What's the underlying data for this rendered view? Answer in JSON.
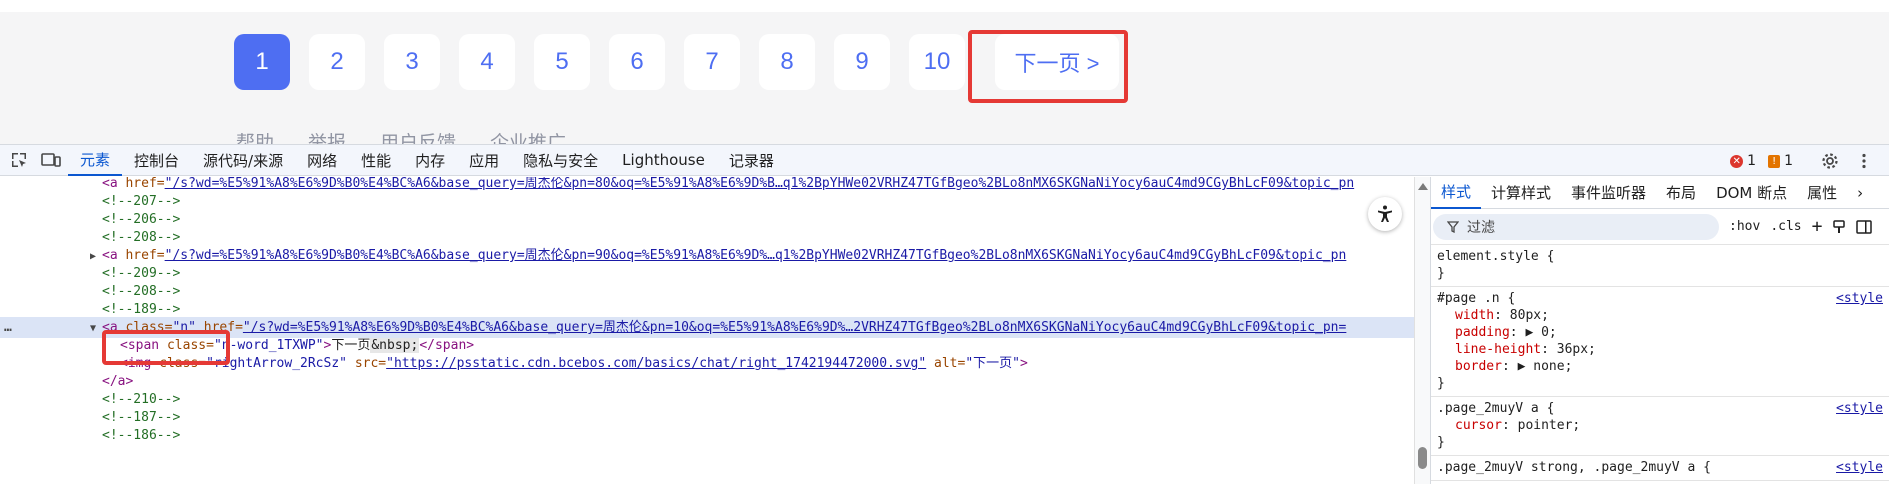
{
  "pager": {
    "pages": [
      "1",
      "2",
      "3",
      "4",
      "5",
      "6",
      "7",
      "8",
      "9",
      "10"
    ],
    "active_page": "1",
    "next_label": "下一页 >"
  },
  "footer_links": [
    "帮助",
    "举报",
    "用户反馈",
    "企业推广"
  ],
  "devtools": {
    "tabs": [
      "元素",
      "控制台",
      "源代码/来源",
      "网络",
      "性能",
      "内存",
      "应用",
      "隐私与安全",
      "Lighthouse",
      "记录器"
    ],
    "active_tab": "元素",
    "error_count": "1",
    "warning_count": "1",
    "error_glyph": "✕",
    "warning_glyph": "!"
  },
  "elements": {
    "lines": [
      {
        "type": "link-partial",
        "indent": 2,
        "tag_open": "<a ",
        "attr": "href=",
        "val": "\"/s?wd=%E5%91%A8%E6%9D%B0%E4%BC%A6&base_query=周杰伦&pn=80&oq=%E5%91%A8%E6%9D%B…q1%2BpYHWe02VRHZ47TGfBgeo%2BLo8nMX6SKGNaNiYocy6auC4md9CGyBhLcF09&topic_pn"
      },
      {
        "type": "comment",
        "indent": 2,
        "text": "<!--207-->"
      },
      {
        "type": "comment",
        "indent": 2,
        "text": "<!--206-->"
      },
      {
        "type": "comment",
        "indent": 2,
        "text": "<!--208-->"
      },
      {
        "type": "link",
        "indent": 2,
        "tri": "▶",
        "tag_open": "<a ",
        "attr": "href=",
        "val": "\"/s?wd=%E5%91%A8%E6%9D%B0%E4%BC%A6&base_query=周杰伦&pn=90&oq=%E5%91%A8%E6%9D%…q1%2BpYHWe02VRHZ47TGfBgeo%2BLo8nMX6SKGNaNiYocy6auC4md9CGyBhLcF09&topic_pn"
      },
      {
        "type": "comment",
        "indent": 2,
        "text": "<!--209-->"
      },
      {
        "type": "comment",
        "indent": 2,
        "text": "<!--208-->"
      },
      {
        "type": "comment",
        "indent": 2,
        "text": "<!--189-->"
      },
      {
        "type": "selected",
        "indent": 2,
        "tri": "▼",
        "tag_open": "<a ",
        "class_attr": "class=",
        "class_val": "\"n\"",
        "attr": " href=",
        "val": "\"/s?wd=%E5%91%A8%E6%9D%B0%E4%BC%A6&base_query=周杰伦&pn=10&oq=%E5%91%A8%E6%9D%…2VRHZ47TGfBgeo%2BLo8nMX6SKGNaNiYocy6auC4md9CGyBhLcF09&topic_pn="
      },
      {
        "type": "span",
        "indent": 3,
        "tag_open": "<span ",
        "attr": "class=",
        "val": "\"n-word_1TXWP\"",
        "close_open": ">",
        "text": "下一页",
        "nbsp": "&nbsp;",
        "tag_close": "</span>"
      },
      {
        "type": "img",
        "indent": 3,
        "tag_open": "<img ",
        "attr1": "class=",
        "val1": "\"rightArrow_2RcSz\"",
        "attr2": " src=",
        "val2": "\"https://psstatic.cdn.bcebos.com/basics/chat/right_1742194472000.svg\"",
        "attr3": " alt=",
        "val3": "\"下一页\"",
        "tag_end": ">"
      },
      {
        "type": "close",
        "indent": 2,
        "text": "</a>"
      },
      {
        "type": "comment",
        "indent": 2,
        "text": "<!--210-->"
      },
      {
        "type": "comment",
        "indent": 2,
        "text": "<!--187-->"
      },
      {
        "type": "comment",
        "indent": 2,
        "text": "<!--186-->"
      }
    ],
    "selected_dots": "…"
  },
  "styles_panel": {
    "tabs": [
      "样式",
      "计算样式",
      "事件监听器",
      "布局",
      "DOM 断点",
      "属性"
    ],
    "active_tab": "样式",
    "filter_placeholder": "过滤",
    "hov_label": ":hov",
    "cls_label": ".cls",
    "plus_label": "+",
    "rules": [
      {
        "selector": "element.style {",
        "props": [],
        "close": "}",
        "source": ""
      },
      {
        "selector": "#page .n {",
        "props": [
          {
            "name": "width",
            "value": "80px;"
          },
          {
            "name": "padding",
            "value": "▶ 0;"
          },
          {
            "name": "line-height",
            "value": "36px;"
          },
          {
            "name": "border",
            "value": "▶ none;"
          }
        ],
        "close": "}",
        "source": "<style"
      },
      {
        "selector": ".page_2muyV a {",
        "props": [
          {
            "name": "cursor",
            "value": "pointer;"
          }
        ],
        "close": "}",
        "source": "<style"
      },
      {
        "selector": ".page_2muyV strong, .page_2muyV a {",
        "props": [],
        "close": "",
        "source": "<style"
      }
    ]
  }
}
